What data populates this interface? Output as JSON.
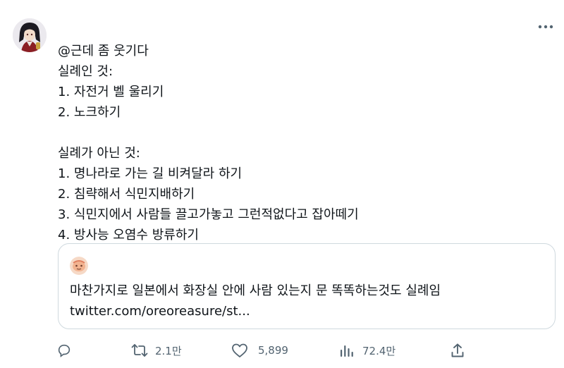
{
  "tweet": {
    "lines": [
      "@근데 좀 웃기다",
      "실례인 것:",
      "1. 자전거 벨 울리기",
      "2. 노크하기",
      "",
      "실례가 아닌 것:",
      "1. 명나라로 가는 길 비켜달라 하기",
      "2. 침략해서 식민지배하기",
      "3. 식민지에서 사람들 끌고가놓고 그런적없다고 잡아떼기",
      "4. 방사능 오염수 방류하기"
    ]
  },
  "quote": {
    "text": "마찬가지로 일본에서 화장실 안에 사람 있는지 문 똑똑하는것도 실례임",
    "link": "twitter.com/oreoreasure/st..."
  },
  "actions": {
    "reply_icon": "reply-icon",
    "retweet_icon": "retweet-icon",
    "retweet_count": "2.1만",
    "like_icon": "heart-icon",
    "like_count": "5,899",
    "views_icon": "views-icon",
    "views_count": "72.4만",
    "share_icon": "share-icon"
  },
  "colors": {
    "text": "#0f1419",
    "muted": "#536471",
    "border": "#cfd9de"
  }
}
